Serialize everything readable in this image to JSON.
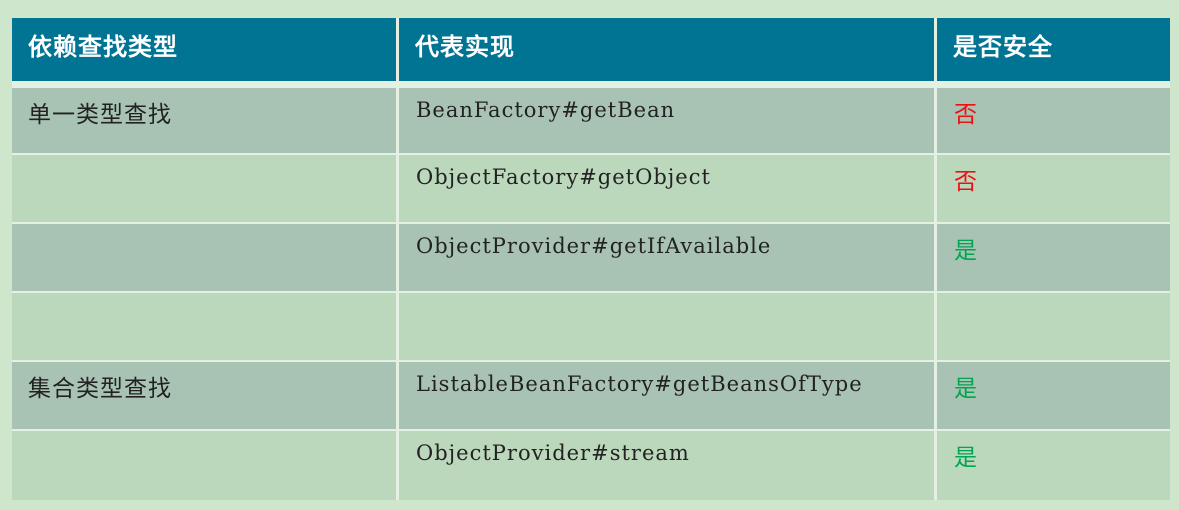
{
  "colors": {
    "background": "#cde6cc",
    "header_bg": "#017494",
    "row_odd": "#a8c3b3",
    "row_even": "#bcd8bc",
    "unsafe": "#ee1111",
    "safe": "#00a550"
  },
  "headers": [
    "依赖查找类型",
    "代表实现",
    "是否安全"
  ],
  "rows": [
    {
      "type": "单一类型查找",
      "impl": "BeanFactory#getBean",
      "safe": "否"
    },
    {
      "type": "",
      "impl": "ObjectFactory#getObject",
      "safe": "否"
    },
    {
      "type": "",
      "impl": "ObjectProvider#getIfAvailable",
      "safe": "是"
    },
    {
      "type": "",
      "impl": "",
      "safe": ""
    },
    {
      "type": "集合类型查找",
      "impl": "ListableBeanFactory#getBeansOfType",
      "safe": "是"
    },
    {
      "type": "",
      "impl": "ObjectProvider#stream",
      "safe": "是"
    }
  ]
}
